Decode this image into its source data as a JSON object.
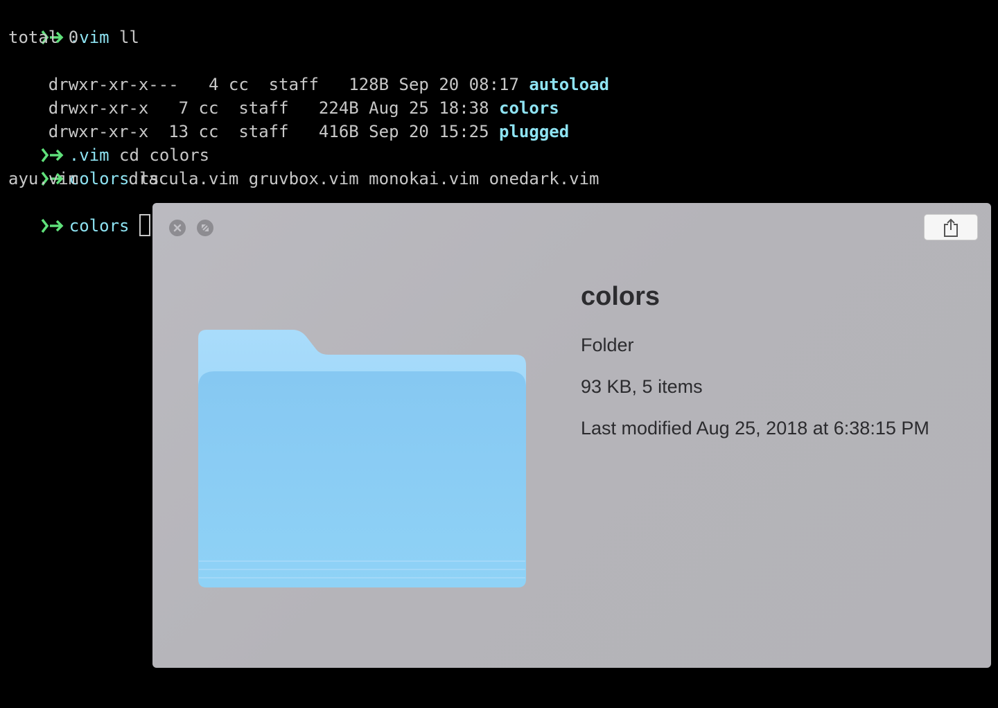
{
  "colors": {
    "prompt_arrow": "#5fe07a",
    "directory": "#8ee3f2",
    "text": "#c8c8c8",
    "folder_blue": "#8cd0f5"
  },
  "terminal": {
    "lines": [
      {
        "kind": "prompt",
        "cwd": ".vim",
        "command": " ll"
      },
      {
        "kind": "text",
        "text": "total 0"
      },
      {
        "kind": "entry",
        "perms": "drwxr-xr-x---   4 cc  staff   128B Sep 20 08:17 ",
        "name": "autoload"
      },
      {
        "kind": "entry",
        "perms": "drwxr-xr-x   7 cc  staff   224B Aug 25 18:38 ",
        "name": "colors"
      },
      {
        "kind": "entry",
        "perms": "drwxr-xr-x  13 cc  staff   416B Sep 20 15:25 ",
        "name": "plugged"
      },
      {
        "kind": "prompt",
        "cwd": ".vim",
        "command": " cd colors"
      },
      {
        "kind": "prompt",
        "cwd": "colors",
        "command": " ls"
      },
      {
        "kind": "text",
        "text": "ayu.vim     dracula.vim gruvbox.vim monokai.vim onedark.vim"
      },
      {
        "kind": "prompt",
        "cwd": "colors",
        "command": ""
      }
    ]
  },
  "quicklook": {
    "close_icon": "close-icon",
    "fullscreen_icon": "fullscreen-icon",
    "share_icon": "share-icon",
    "folder_icon": "folder-icon",
    "name": "colors",
    "kind": "Folder",
    "size": "93 KB, 5 items",
    "modified": "Last modified Aug 25, 2018 at 6:38:15 PM"
  }
}
